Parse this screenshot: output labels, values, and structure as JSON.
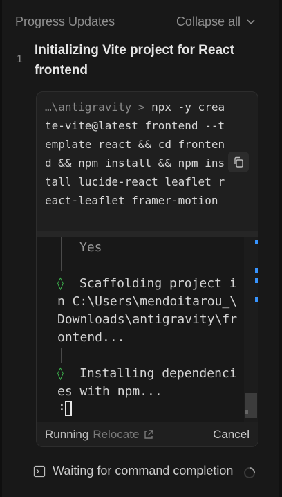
{
  "header": {
    "title": "Progress Updates",
    "collapse_label": "Collapse all"
  },
  "step": {
    "number": "1",
    "title": "Initializing Vite project for React frontend"
  },
  "command": {
    "path": "…\\antigravity > ",
    "text": "npx -y create-vite@latest frontend --template react && cd frontend && npm install && npm install lucide-react leaflet react-leaflet framer-motion"
  },
  "terminal": {
    "line_yes": "Yes",
    "scaffold_lines": [
      "Scaffolding project i",
      "n C:\\Users\\mendoitarou_\\",
      "Downloads\\antigravity\\fr",
      "ontend..."
    ],
    "install_lines": [
      "Installing dependenci",
      "es with npm..."
    ],
    "prompt_glyph": ":"
  },
  "footer": {
    "status": "Running",
    "relocate_label": "Relocate",
    "cancel_label": "Cancel"
  },
  "waiting": {
    "label": "Waiting for command completion"
  },
  "icons": {
    "collapse": "chevron-down-icon",
    "copy": "copy-icon",
    "relocate": "external-link-icon",
    "waiting": "terminal-icon",
    "spinner": "spinner-icon"
  },
  "colors": {
    "accent": "#3794ff",
    "success": "#3fb950",
    "background": "#181818"
  }
}
